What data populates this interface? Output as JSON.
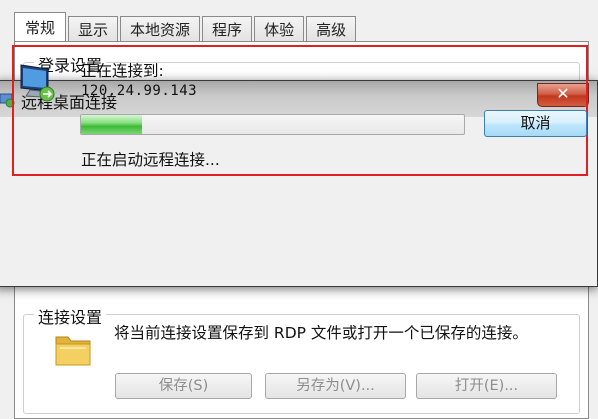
{
  "background_window": {
    "tabs": [
      "常规",
      "显示",
      "本地资源",
      "程序",
      "体验",
      "高级"
    ],
    "active_tab": 0,
    "login_group_title": "登录设置",
    "connection_group": {
      "title": "连接设置",
      "description": "将当前连接设置保存到 RDP 文件或打开一个已保存的连接。",
      "save_button": "保存(S)",
      "save_as_button": "另存为(V)...",
      "open_button": "打开(E)..."
    }
  },
  "dialog": {
    "title": "远程桌面连接",
    "close_label": "✕",
    "connecting_label": "正在连接到:",
    "address": "120.24.99.143",
    "progress_fraction": 0.16,
    "cancel_label": "取消",
    "status": "正在启动远程连接..."
  },
  "colors": {
    "highlight_border": "#e02020",
    "progress_green": "#3dbb37",
    "close_red": "#c0391f"
  },
  "icons": {
    "title_icon": "remote-desktop-icon",
    "dialog_icon": "monitor-connect-icon",
    "folder_icon": "folder-icon"
  }
}
